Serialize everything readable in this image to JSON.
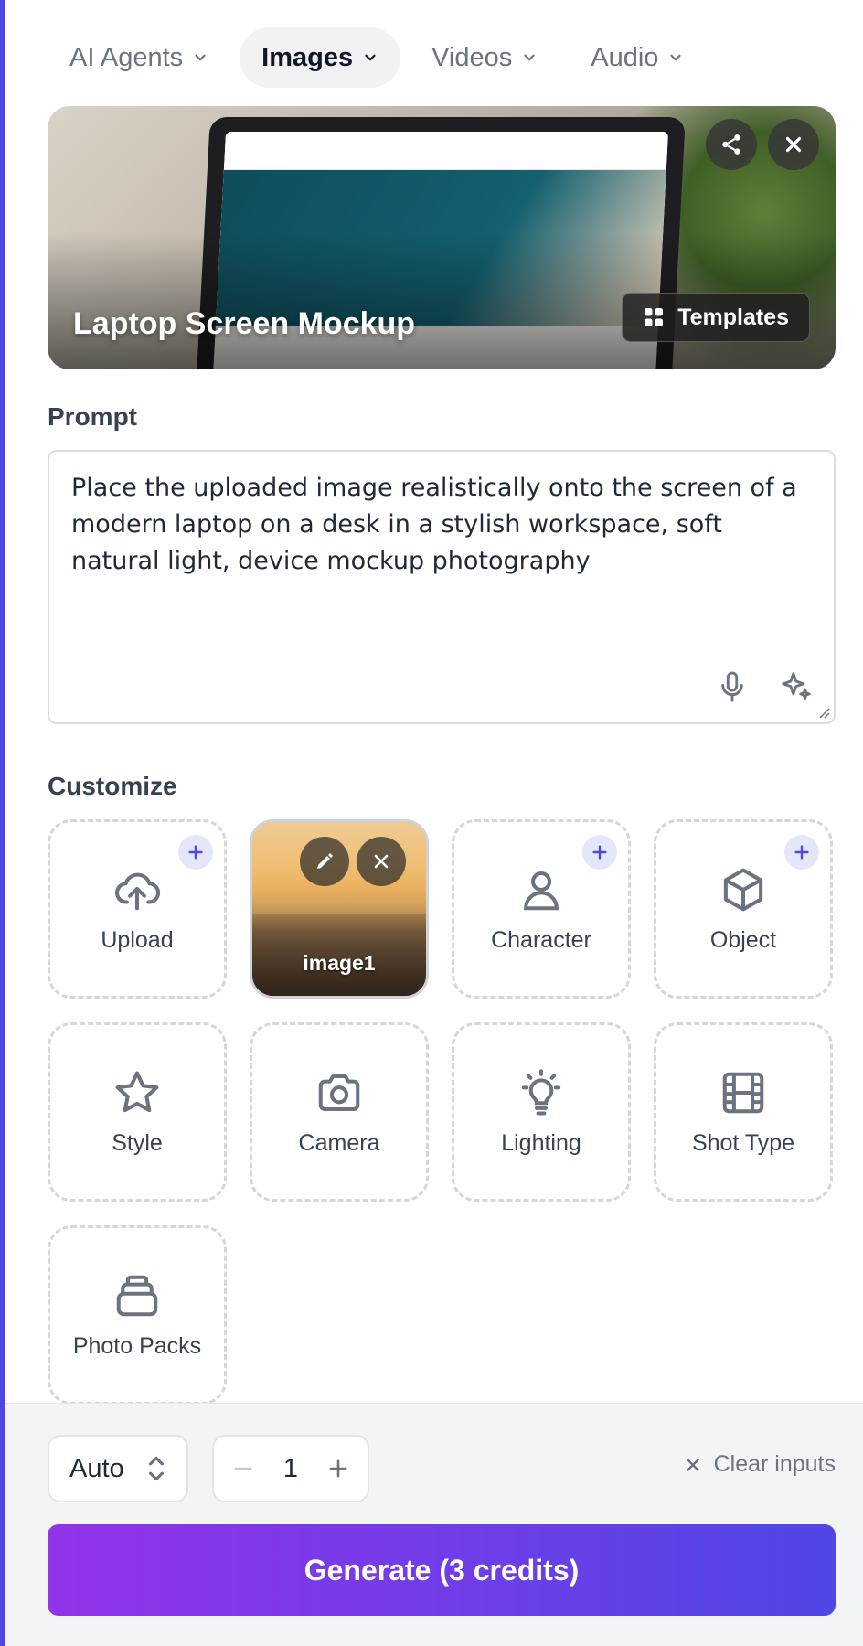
{
  "colors": {
    "accent": "#4f46e5",
    "gradient_start": "#9333ea",
    "gradient_end": "#4f46e5",
    "badge_bg": "#e4e6fb"
  },
  "nav": {
    "tabs": [
      {
        "label": "AI Agents",
        "active": false
      },
      {
        "label": "Images",
        "active": true
      },
      {
        "label": "Videos",
        "active": false
      },
      {
        "label": "Audio",
        "active": false
      }
    ]
  },
  "hero": {
    "title": "Laptop Screen Mockup",
    "templates_label": "Templates",
    "share_icon": "share-icon",
    "close_icon": "close-icon"
  },
  "prompt": {
    "label": "Prompt",
    "text": "Place the uploaded image realistically onto the screen of a modern laptop on a desk in a stylish workspace, soft natural light, device mockup photography"
  },
  "customize": {
    "label": "Customize",
    "tiles": [
      {
        "label": "Upload",
        "icon": "cloud-upload-icon",
        "plus": true
      },
      {
        "label": "image1",
        "icon": "image-thumbnail"
      },
      {
        "label": "Character",
        "icon": "user-icon",
        "plus": true
      },
      {
        "label": "Object",
        "icon": "cube-icon",
        "plus": true
      },
      {
        "label": "Style",
        "icon": "star-icon"
      },
      {
        "label": "Camera",
        "icon": "camera-icon"
      },
      {
        "label": "Lighting",
        "icon": "lightbulb-icon"
      },
      {
        "label": "Shot Type",
        "icon": "film-icon"
      },
      {
        "label": "Photo Packs",
        "icon": "stack-icon"
      }
    ]
  },
  "bottom": {
    "aspect_value": "Auto",
    "count_value": "1",
    "clear_label": "Clear inputs",
    "generate_label": "Generate (3 credits)"
  }
}
